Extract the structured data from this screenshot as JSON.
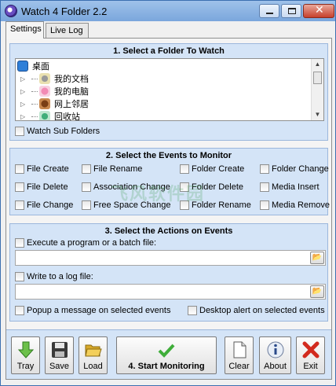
{
  "window": {
    "title": "Watch 4 Folder 2.2"
  },
  "tabs": [
    {
      "label": "Settings"
    },
    {
      "label": "Live Log"
    }
  ],
  "folder_section": {
    "title": "1. Select a Folder To Watch",
    "tree": [
      {
        "label": "桌面",
        "icon": "desktop-icon"
      },
      {
        "label": "我的文档",
        "icon": "my-documents-icon"
      },
      {
        "label": "我的电脑",
        "icon": "my-computer-icon"
      },
      {
        "label": "网上邻居",
        "icon": "network-icon"
      },
      {
        "label": "回收站",
        "icon": "recycle-bin-icon"
      }
    ],
    "watch_sub_folders": "Watch Sub Folders"
  },
  "events_section": {
    "title": "2. Select the Events to Monitor",
    "events": [
      "File Create",
      "File Rename",
      "Folder Create",
      "Folder Change",
      "File Delete",
      "Association Change",
      "Folder Delete",
      "Media Insert",
      "File Change",
      "Free Space Change",
      "Folder Rename",
      "Media Remove"
    ]
  },
  "actions_section": {
    "title": "3. Select the Actions on Events",
    "execute_label": "Execute a program or a batch file:",
    "execute_value": "",
    "log_label": "Write to a log file:",
    "log_value": "",
    "popup_label": "Popup a message on selected events",
    "desktop_alert_label": "Desktop alert on selected events"
  },
  "toolbar": {
    "tray": "Tray",
    "save": "Save",
    "load": "Load",
    "start": "4. Start Monitoring",
    "clear": "Clear",
    "about": "About",
    "exit": "Exit"
  },
  "watermark": "飞风软件园",
  "colors": {
    "group_bg": "#d4e4f7",
    "titlebar": "#7aa6dc",
    "close_button": "#c7402c"
  }
}
